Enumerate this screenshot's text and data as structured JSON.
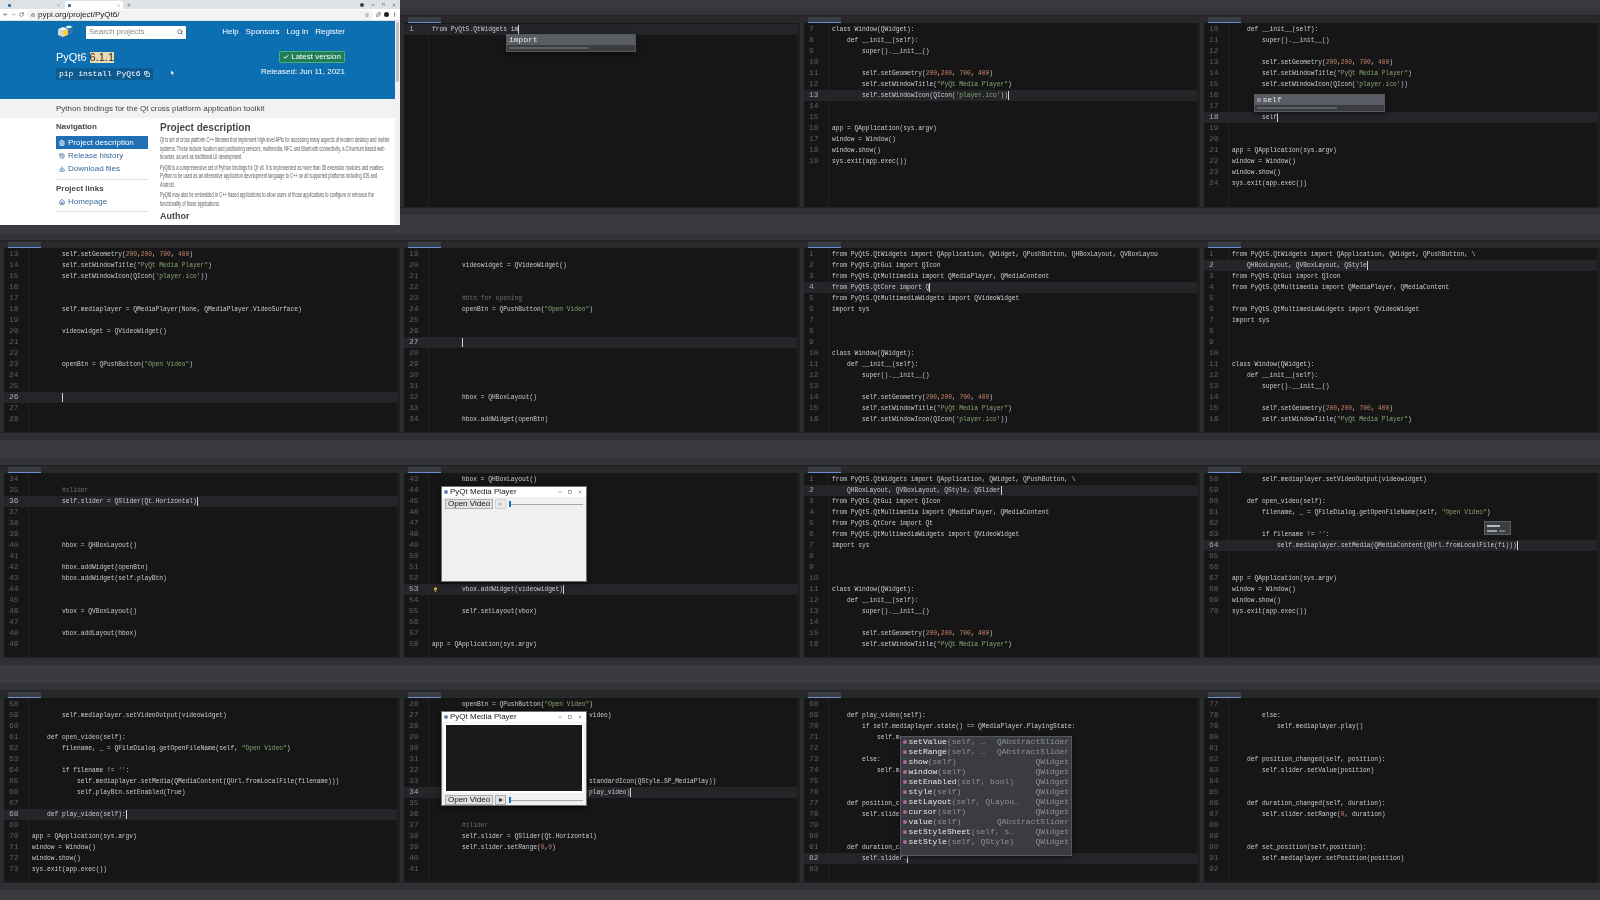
{
  "tiles": [
    {
      "kind": "browser",
      "tabs": [
        {
          "selected": false
        },
        {
          "selected": true
        }
      ],
      "url": "pypi.org/project/PyQt6/",
      "search_placeholder": "Search projects",
      "nav": [
        "Help",
        "Sponsors",
        "Log in",
        "Register"
      ],
      "title": "PyQt6",
      "version": "6.1.1",
      "version_highlighted": true,
      "install": "pip install PyQt6",
      "latest_button": "Latest version",
      "released": "Released: Jun 11, 2021",
      "summary": "Python bindings for the Qt cross platform application toolkit",
      "navigation_heading": "Navigation",
      "navigation": [
        {
          "label": "Project description",
          "selected": true
        },
        {
          "label": "Release history",
          "selected": false
        },
        {
          "label": "Download files",
          "selected": false
        }
      ],
      "links_heading": "Project links",
      "links": [
        "Homepage"
      ],
      "description_heading": "Project description",
      "paragraphs": [
        "Qt is set of cross platform C++ libraries that implement high-level APIs for accessing many aspects of modern desktop and mobile systems. These include location and positioning services, multimedia, NFC and Bluetooth connectivity, a Chromium based web browser, as well as traditional UI development.",
        "PyQt6 is a comprehensive set of Python bindings for Qt v6. It is implemented as more than 35 extension modules and enables Python to be used as an alternative application development language to C++ on all supported platforms including iOS and Android.",
        "PyQt6 may also be embedded in C++ based applications to allow users of those applications to configure or enhance the functionality of those applications."
      ],
      "author_heading": "Author"
    },
    {
      "kind": "ide",
      "lines": [
        {
          "n": "1",
          "code": "from PyQt5.QtWidgets im",
          "current": true
        }
      ],
      "completion": {
        "kind": "short",
        "items": [
          {
            "kind": "keyword",
            "name": "import",
            "selected": true
          }
        ]
      }
    },
    {
      "kind": "ide",
      "lines": [
        {
          "n": "7",
          "code": "class Window(QWidget):",
          "current": false
        },
        {
          "n": "8",
          "code": "    def __init__(self):",
          "current": false
        },
        {
          "n": "9",
          "code": "        super().__init__()",
          "current": false
        },
        {
          "n": "10",
          "current": false
        },
        {
          "n": "11",
          "code": "        self.setGeometry(200,200, 700, 400)",
          "current": false
        },
        {
          "n": "12",
          "code": "        self.setWindowTitle(\"PyQt Media Player\")",
          "current": false
        },
        {
          "n": "13",
          "code": "        self.setWindowIcon(QIcon('player.ico'))",
          "current": true
        },
        {
          "n": "14",
          "current": false
        },
        {
          "n": "15",
          "current": false
        },
        {
          "n": "16",
          "code": "app = QApplication(sys.argv)",
          "current": false
        },
        {
          "n": "17",
          "code": "window = Window()",
          "current": false
        },
        {
          "n": "18",
          "code": "window.show()",
          "current": false
        },
        {
          "n": "19",
          "code": "sys.exit(app.exec())",
          "current": false
        }
      ]
    },
    {
      "kind": "ide",
      "lines": [
        {
          "n": "10",
          "code": "    def __init__(self):",
          "current": false
        },
        {
          "n": "11",
          "code": "        super().__init__()",
          "current": false
        },
        {
          "n": "12",
          "current": false
        },
        {
          "n": "13",
          "code": "        self.setGeometry(200,200, 700, 400)",
          "current": false
        },
        {
          "n": "14",
          "code": "        self.setWindowTitle(\"PyQt Media Player\")",
          "current": false
        },
        {
          "n": "15",
          "code": "        self.setWindowIcon(QIcon('player.ico'))",
          "current": false
        },
        {
          "n": "16",
          "current": false
        },
        {
          "n": "17",
          "current": false
        },
        {
          "n": "18",
          "code": "        self",
          "current": true
        },
        {
          "n": "19",
          "current": false
        },
        {
          "n": "20",
          "current": false
        },
        {
          "n": "21",
          "code": "app = QApplication(sys.argv)",
          "current": false
        },
        {
          "n": "22",
          "code": "window = Window()",
          "current": false
        },
        {
          "n": "23",
          "code": "window.show()",
          "current": false
        },
        {
          "n": "24",
          "code": "sys.exit(app.exec())",
          "current": false
        }
      ],
      "completion": {
        "kind": "short",
        "items": [
          {
            "kind": "parameter",
            "name": "self",
            "selected": true
          }
        ]
      }
    },
    {
      "kind": "ide",
      "lines": [
        {
          "n": "13",
          "code": "        self.setGeometry(200,200, 700, 400)",
          "current": false
        },
        {
          "n": "14",
          "code": "        self.setWindowTitle(\"PyQt Media Player\")",
          "current": false
        },
        {
          "n": "15",
          "code": "        self.setWindowIcon(QIcon('player.ico'))",
          "current": false
        },
        {
          "n": "16",
          "current": false
        },
        {
          "n": "17",
          "current": false
        },
        {
          "n": "18",
          "code": "        self.mediaplayer = QMediaPlayer(None, QMediaPlayer.VideoSurface)",
          "current": false
        },
        {
          "n": "19",
          "current": false
        },
        {
          "n": "20",
          "code": "        videowidget = QVideoWidget()",
          "current": false
        },
        {
          "n": "21",
          "current": false
        },
        {
          "n": "22",
          "current": false
        },
        {
          "n": "23",
          "code": "        openBtn = QPushButton(\"Open Video\")",
          "current": false
        },
        {
          "n": "24",
          "current": false
        },
        {
          "n": "25",
          "current": false
        },
        {
          "n": "26",
          "current": true
        },
        {
          "n": "27",
          "current": false
        },
        {
          "n": "28",
          "current": false
        }
      ]
    },
    {
      "kind": "ide",
      "lines": [
        {
          "n": "19",
          "current": false
        },
        {
          "n": "20",
          "code": "        videowidget = QVideoWidget()",
          "current": false
        },
        {
          "n": "21",
          "current": false
        },
        {
          "n": "22",
          "current": false
        },
        {
          "n": "23",
          "code": "        #btn for opening",
          "current": false
        },
        {
          "n": "24",
          "code": "        openBtn = QPushButton(\"Open Video\")",
          "current": false
        },
        {
          "n": "25",
          "current": false
        },
        {
          "n": "26",
          "current": false
        },
        {
          "n": "27",
          "current": true
        },
        {
          "n": "28",
          "current": false
        },
        {
          "n": "29",
          "current": false
        },
        {
          "n": "30",
          "current": false
        },
        {
          "n": "31",
          "current": false
        },
        {
          "n": "32",
          "code": "        hbox = QHBoxLayout()",
          "current": false
        },
        {
          "n": "33",
          "current": false
        },
        {
          "n": "34",
          "code": "        hbox.addWidget(openBtn)",
          "current": false
        }
      ]
    },
    {
      "kind": "ide",
      "lines": [
        {
          "n": "1",
          "code": "from PyQt5.QtWidgets import QApplication, QWidget, QPushButton, QHBoxLayout, QVBoxLayou",
          "current": false
        },
        {
          "n": "2",
          "code": "from PyQt5.QtGui import QIcon",
          "current": false
        },
        {
          "n": "3",
          "code": "from PyQt5.QtMultimedia import QMediaPlayer, QMediaContent",
          "current": false
        },
        {
          "n": "4",
          "code": "from PyQt5.QtCore import Q",
          "current": true
        },
        {
          "n": "5",
          "code": "from PyQt5.QtMultimediaWidgets import QVideoWidget",
          "current": false
        },
        {
          "n": "6",
          "code": "import sys",
          "current": false
        },
        {
          "n": "7",
          "current": false
        },
        {
          "n": "8",
          "current": false
        },
        {
          "n": "9",
          "current": false
        },
        {
          "n": "10",
          "code": "class Window(QWidget):",
          "current": false
        },
        {
          "n": "11",
          "code": "    def __init__(self):",
          "current": false
        },
        {
          "n": "12",
          "code": "        super().__init__()",
          "current": false
        },
        {
          "n": "13",
          "current": false
        },
        {
          "n": "14",
          "code": "        self.setGeometry(200,200, 700, 400)",
          "current": false
        },
        {
          "n": "15",
          "code": "        self.setWindowTitle(\"PyQt Media Player\")",
          "current": false
        },
        {
          "n": "16",
          "code": "        self.setWindowIcon(QIcon('player.ico'))",
          "current": false
        }
      ]
    },
    {
      "kind": "ide",
      "lines": [
        {
          "n": "1",
          "code": "from PyQt5.QtWidgets import QApplication, QWidget, QPushButton, \\",
          "current": false
        },
        {
          "n": "2",
          "code": "    QHBoxLayout, QVBoxLayout, QStyle",
          "current": true
        },
        {
          "n": "3",
          "code": "from PyQt5.QtGui import QIcon",
          "current": false
        },
        {
          "n": "4",
          "code": "from PyQt5.QtMultimedia import QMediaPlayer, QMediaContent",
          "current": false
        },
        {
          "n": "5",
          "current": false
        },
        {
          "n": "6",
          "code": "from PyQt5.QtMultimediaWidgets import QVideoWidget",
          "current": false
        },
        {
          "n": "7",
          "code": "import sys",
          "current": false
        },
        {
          "n": "8",
          "current": false
        },
        {
          "n": "9",
          "current": false
        },
        {
          "n": "10",
          "current": false
        },
        {
          "n": "11",
          "code": "class Window(QWidget):",
          "current": false
        },
        {
          "n": "12",
          "code": "    def __init__(self):",
          "current": false
        },
        {
          "n": "13",
          "code": "        super().__init__()",
          "current": false
        },
        {
          "n": "14",
          "current": false
        },
        {
          "n": "15",
          "code": "        self.setGeometry(200,200, 700, 400)",
          "current": false
        },
        {
          "n": "16",
          "code": "        self.setWindowTitle(\"PyQt Media Player\")",
          "current": false
        }
      ]
    },
    {
      "kind": "ide",
      "lines": [
        {
          "n": "34",
          "current": false
        },
        {
          "n": "35",
          "code": "        #slider",
          "current": false
        },
        {
          "n": "36",
          "code": "        self.slider = QSlider(Qt.Horizontal)",
          "current": true
        },
        {
          "n": "37",
          "current": false
        },
        {
          "n": "38",
          "current": false
        },
        {
          "n": "39",
          "current": false
        },
        {
          "n": "40",
          "code": "        hbox = QHBoxLayout()",
          "current": false
        },
        {
          "n": "41",
          "current": false
        },
        {
          "n": "42",
          "code": "        hbox.addWidget(openBtn)",
          "current": false
        },
        {
          "n": "43",
          "code": "        hbox.addWidget(self.playBtn)",
          "current": false
        },
        {
          "n": "44",
          "current": false
        },
        {
          "n": "45",
          "current": false
        },
        {
          "n": "46",
          "code": "        vbox = QVBoxLayout()",
          "current": false
        },
        {
          "n": "47",
          "current": false
        },
        {
          "n": "48",
          "code": "        vbox.addLayout(hbox)",
          "current": false
        },
        {
          "n": "49",
          "current": false
        }
      ]
    },
    {
      "kind": "ide",
      "bulb": true,
      "lines": [
        {
          "n": "43",
          "code": "        hbox = QHBoxLayout()",
          "current": false
        },
        {
          "n": "44",
          "current": false
        },
        {
          "n": "45",
          "current": false
        },
        {
          "n": "46",
          "current": false
        },
        {
          "n": "47",
          "current": false
        },
        {
          "n": "48",
          "current": false
        },
        {
          "n": "49",
          "current": false
        },
        {
          "n": "50",
          "current": false
        },
        {
          "n": "51",
          "current": false
        },
        {
          "n": "52",
          "current": false
        },
        {
          "n": "53",
          "code": "        vbox.addWidget(videowidget)",
          "current": true
        },
        {
          "n": "54",
          "current": false
        },
        {
          "n": "55",
          "code": "        self.setLayout(vbox)",
          "current": false
        },
        {
          "n": "56",
          "current": false
        },
        {
          "n": "57",
          "current": false
        },
        {
          "n": "58",
          "code": "app = QApplication(sys.argv)",
          "current": false
        }
      ],
      "app_window": {
        "title": "PyQt Media Player",
        "open_button": "Open Video",
        "play_enabled": false,
        "video_frame": false,
        "slider": {
          "level": 0
        }
      }
    },
    {
      "kind": "ide",
      "lines": [
        {
          "n": "1",
          "code": "from PyQt5.QtWidgets import QApplication, QWidget, QPushButton, \\",
          "current": false
        },
        {
          "n": "2",
          "code": "    QHBoxLayout, QVBoxLayout, QStyle, QSlider",
          "current": true
        },
        {
          "n": "3",
          "code": "from PyQt5.QtGui import QIcon",
          "current": false
        },
        {
          "n": "4",
          "code": "from PyQt5.QtMultimedia import QMediaPlayer, QMediaContent",
          "current": false
        },
        {
          "n": "5",
          "code": "from PyQt5.QtCore import Qt",
          "current": false
        },
        {
          "n": "6",
          "code": "from PyQt5.QtMultimediaWidgets import QVideoWidget",
          "current": false
        },
        {
          "n": "7",
          "code": "import sys",
          "current": false
        },
        {
          "n": "8",
          "current": false
        },
        {
          "n": "9",
          "current": false
        },
        {
          "n": "10",
          "current": false
        },
        {
          "n": "11",
          "code": "class Window(QWidget):",
          "current": false
        },
        {
          "n": "12",
          "code": "    def __init__(self):",
          "current": false
        },
        {
          "n": "13",
          "code": "        super().__init__()",
          "current": false
        },
        {
          "n": "14",
          "current": false
        },
        {
          "n": "15",
          "code": "        self.setGeometry(200,200, 700, 400)",
          "current": false
        },
        {
          "n": "16",
          "code": "        self.setWindowTitle(\"PyQt Media Player\")",
          "current": false
        }
      ]
    },
    {
      "kind": "ide",
      "tooltip": true,
      "lines": [
        {
          "n": "58",
          "code": "        self.mediaplayer.setVideoOutput(videowidget)",
          "current": false
        },
        {
          "n": "59",
          "current": false
        },
        {
          "n": "60",
          "code": "    def open_video(self):",
          "current": false
        },
        {
          "n": "61",
          "code": "        filename, _ = QFileDialog.getOpenFileName(self, \"Open Video\")",
          "current": false
        },
        {
          "n": "62",
          "current": false
        },
        {
          "n": "63",
          "code": "        if filename != '':",
          "current": false
        },
        {
          "n": "64",
          "code": "            self.mediaplayer.setMedia(QMediaContent(QUrl.fromLocalFile(fi)))",
          "current": true
        },
        {
          "n": "65",
          "current": false
        },
        {
          "n": "66",
          "current": false
        },
        {
          "n": "67",
          "code": "app = QApplication(sys.argv)",
          "current": false
        },
        {
          "n": "68",
          "code": "window = Window()",
          "current": false
        },
        {
          "n": "69",
          "code": "window.show()",
          "current": false
        },
        {
          "n": "70",
          "code": "sys.exit(app.exec())",
          "current": false
        }
      ]
    },
    {
      "kind": "ide",
      "lines": [
        {
          "n": "58",
          "current": false
        },
        {
          "n": "59",
          "code": "        self.mediaplayer.setVideoOutput(videowidget)",
          "current": false
        },
        {
          "n": "60",
          "current": false
        },
        {
          "n": "61",
          "code": "    def open_video(self):",
          "current": false
        },
        {
          "n": "62",
          "code": "        filename, _ = QFileDialog.getOpenFileName(self, \"Open Video\")",
          "current": false
        },
        {
          "n": "63",
          "current": false
        },
        {
          "n": "64",
          "code": "        if filename != '':",
          "current": false
        },
        {
          "n": "65",
          "code": "            self.mediaplayer.setMedia(QMediaContent(QUrl.fromLocalFile(filename)))",
          "current": false
        },
        {
          "n": "66",
          "code": "            self.playBtn.setEnabled(True)",
          "current": false
        },
        {
          "n": "67",
          "current": false
        },
        {
          "n": "68",
          "code": "    def play_video(self):",
          "current": true
        },
        {
          "n": "69",
          "current": false
        },
        {
          "n": "70",
          "code": "app = QApplication(sys.argv)",
          "current": false
        },
        {
          "n": "71",
          "code": "window = Window()",
          "current": false
        },
        {
          "n": "72",
          "code": "window.show()",
          "current": false
        },
        {
          "n": "73",
          "code": "sys.exit(app.exec())",
          "current": false
        }
      ]
    },
    {
      "kind": "ide",
      "lines": [
        {
          "n": "26",
          "code": "        openBtn = QPushButton(\"Open Video\")",
          "current": false
        },
        {
          "n": "27",
          "code": "                                          video)",
          "current": false
        },
        {
          "n": "28",
          "current": false
        },
        {
          "n": "29",
          "current": false
        },
        {
          "n": "30",
          "current": false
        },
        {
          "n": "31",
          "current": false
        },
        {
          "n": "32",
          "current": false
        },
        {
          "n": "33",
          "code": "                                          standardIcon(QStyle.SP_MediaPlay))",
          "current": false
        },
        {
          "n": "34",
          "code": "                                          play_video)",
          "current": true
        },
        {
          "n": "35",
          "current": false
        },
        {
          "n": "36",
          "current": false
        },
        {
          "n": "37",
          "code": "        #slider",
          "current": false
        },
        {
          "n": "38",
          "code": "        self.slider = QSlider(Qt.Horizontal)",
          "current": false
        },
        {
          "n": "39",
          "code": "        self.slider.setRange(0,0)",
          "current": false
        },
        {
          "n": "40",
          "current": false
        },
        {
          "n": "41",
          "current": false
        }
      ],
      "app_window": {
        "title": "PyQt Media Player",
        "open_button": "Open Video",
        "play_enabled": true,
        "video_frame": true,
        "slider": {
          "level": 0
        }
      }
    },
    {
      "kind": "ide",
      "lines": [
        {
          "n": "68",
          "current": false
        },
        {
          "n": "69",
          "code": "    def play_video(self):",
          "current": false
        },
        {
          "n": "70",
          "code": "        if self.mediaplayer.state() == QMediaPlayer.PlayingState:",
          "current": false
        },
        {
          "n": "71",
          "code": "            self.m",
          "current": false
        },
        {
          "n": "72",
          "current": false
        },
        {
          "n": "73",
          "code": "        else:",
          "current": false
        },
        {
          "n": "74",
          "code": "            self.m",
          "current": false
        },
        {
          "n": "75",
          "current": false
        },
        {
          "n": "76",
          "current": false
        },
        {
          "n": "77",
          "code": "    def position_c",
          "current": false
        },
        {
          "n": "78",
          "code": "        self.slide",
          "current": false
        },
        {
          "n": "79",
          "current": false
        },
        {
          "n": "80",
          "current": false
        },
        {
          "n": "81",
          "code": "    def duration_c",
          "current": false
        },
        {
          "n": "82",
          "code": "        self.slider.",
          "current": true
        },
        {
          "n": "83",
          "current": false
        }
      ],
      "completion": {
        "kind": "list",
        "items": [
          {
            "kind": "method",
            "name": "setValue",
            "params": "(self, …",
            "owner": "QAbstractSlider",
            "selected": false
          },
          {
            "kind": "method",
            "name": "setRange",
            "params": "(self, …",
            "owner": "QAbstractSlider",
            "selected": false
          },
          {
            "kind": "method",
            "name": "show",
            "params": "(self)",
            "owner": "QWidget",
            "selected": false
          },
          {
            "kind": "method",
            "name": "window",
            "params": "(self)",
            "owner": "QWidget",
            "selected": false
          },
          {
            "kind": "method",
            "name": "setEnabled",
            "params": "(self, bool)",
            "owner": "QWidget",
            "selected": false
          },
          {
            "kind": "method",
            "name": "style",
            "params": "(self)",
            "owner": "QWidget",
            "selected": false
          },
          {
            "kind": "method",
            "name": "setLayout",
            "params": "(self, QLayou…",
            "owner": "QWidget",
            "selected": false
          },
          {
            "kind": "method",
            "name": "cursor",
            "params": "(self)",
            "owner": "QWidget",
            "selected": false
          },
          {
            "kind": "method",
            "name": "value",
            "params": "(self)",
            "owner": "QAbstractSlider",
            "selected": false
          },
          {
            "kind": "method",
            "name": "setStyleSheet",
            "params": "(self, s…",
            "owner": "QWidget",
            "selected": false
          },
          {
            "kind": "method",
            "name": "setStyle",
            "params": "(self, QStyle)",
            "owner": "QWidget",
            "selected": false
          }
        ]
      }
    },
    {
      "kind": "ide",
      "lines": [
        {
          "n": "77",
          "current": false
        },
        {
          "n": "78",
          "code": "        else:",
          "current": false
        },
        {
          "n": "79",
          "code": "            self.mediaplayer.play()",
          "current": false
        },
        {
          "n": "80",
          "current": false
        },
        {
          "n": "81",
          "current": false
        },
        {
          "n": "82",
          "code": "    def position_changed(self, position):",
          "current": false
        },
        {
          "n": "83",
          "code": "        self.slider.setValue(position)",
          "current": false
        },
        {
          "n": "84",
          "current": false
        },
        {
          "n": "85",
          "current": false
        },
        {
          "n": "86",
          "code": "    def duration_changed(self, duration):",
          "current": false
        },
        {
          "n": "87",
          "code": "        self.slider.setRange(0, duration)",
          "current": false
        },
        {
          "n": "88",
          "current": false
        },
        {
          "n": "89",
          "current": false
        },
        {
          "n": "90",
          "code": "    def set_position(self,position):",
          "current": false
        },
        {
          "n": "91",
          "code": "        self.mediaplayer.setPosition(position)",
          "current": false
        },
        {
          "n": "92",
          "current": false
        }
      ]
    }
  ]
}
